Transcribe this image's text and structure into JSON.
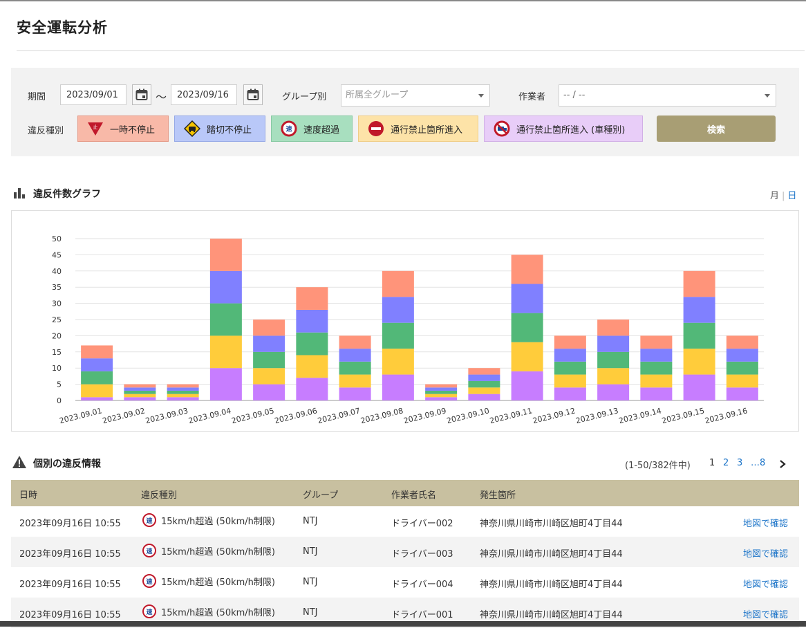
{
  "page": {
    "title": "安全運転分析"
  },
  "filters": {
    "period_label": "期間",
    "date_from": "2023/09/01",
    "date_to": "2023/09/16",
    "tilde": "〜",
    "group_label": "グループ別",
    "group_placeholder": "所属全グループ",
    "worker_label": "作業者",
    "worker_value": "-- / --",
    "violation_label": "違反種別",
    "violation_types": [
      {
        "label": "一時不停止",
        "bg": "#f8b9a8",
        "border": "#e59a87",
        "icon": "stop-sign-icon"
      },
      {
        "label": "踏切不停止",
        "bg": "#b9c8f8",
        "border": "#96a9e6",
        "icon": "railroad-crossing-icon"
      },
      {
        "label": "速度超過",
        "bg": "#a8dfbf",
        "border": "#86c9a2",
        "icon": "speed-limit-icon"
      },
      {
        "label": "通行禁止箇所進入",
        "bg": "#fde3a8",
        "border": "#efcd86",
        "icon": "no-entry-icon"
      },
      {
        "label": "通行禁止箇所進入 (車種別)",
        "bg": "#e8cdf8",
        "border": "#d1afe6",
        "icon": "vehicle-prohibited-icon"
      }
    ],
    "search_label": "検索"
  },
  "chart_section": {
    "title": "違反件数グラフ",
    "toggle_month": "月",
    "toggle_day": "日"
  },
  "chart_data": {
    "type": "bar",
    "stacked": true,
    "categories": [
      "2023.09.01",
      "2023.09.02",
      "2023.09.03",
      "2023.09.04",
      "2023.09.05",
      "2023.09.06",
      "2023.09.07",
      "2023.09.08",
      "2023.09.09",
      "2023.09.10",
      "2023.09.11",
      "2023.09.12",
      "2023.09.13",
      "2023.09.14",
      "2023.09.15",
      "2023.09.16"
    ],
    "series": [
      {
        "color": "#c77dff",
        "values": [
          1,
          1,
          1,
          10,
          5,
          7,
          4,
          8,
          1,
          2,
          9,
          4,
          5,
          4,
          8,
          4
        ]
      },
      {
        "color": "#ffcc3b",
        "values": [
          4,
          1,
          1,
          10,
          5,
          7,
          4,
          8,
          1,
          2,
          9,
          4,
          5,
          4,
          8,
          4
        ]
      },
      {
        "color": "#52b878",
        "values": [
          4,
          1,
          1,
          10,
          5,
          7,
          4,
          8,
          1,
          2,
          9,
          4,
          5,
          4,
          8,
          4
        ]
      },
      {
        "color": "#8080ff",
        "values": [
          4,
          1,
          1,
          10,
          5,
          7,
          4,
          8,
          1,
          2,
          9,
          4,
          5,
          4,
          8,
          4
        ]
      },
      {
        "color": "#ff947a",
        "values": [
          4,
          1,
          1,
          10,
          5,
          7,
          4,
          8,
          1,
          2,
          9,
          4,
          5,
          4,
          8,
          4
        ]
      }
    ],
    "ylim": [
      0,
      50
    ],
    "yticks": [
      0,
      5,
      10,
      15,
      20,
      25,
      30,
      35,
      40,
      45,
      50
    ],
    "grid": true
  },
  "list_section": {
    "title": "個別の違反情報",
    "range_text": "(1-50/382件中)",
    "pages": [
      "1",
      "2",
      "3",
      "…8"
    ]
  },
  "table": {
    "headers": [
      "日時",
      "違反種別",
      "グループ",
      "作業者氏名",
      "発生箇所"
    ],
    "rows": [
      {
        "datetime": "2023年09月16日 10:55",
        "type_icon": "速",
        "type": "15km/h超過 (50km/h制限)",
        "group": "NTJ",
        "worker": "ドライバー002",
        "location": "神奈川県川崎市川崎区旭町4丁目44",
        "link": "地図で確認"
      },
      {
        "datetime": "2023年09月16日 10:55",
        "type_icon": "速",
        "type": "15km/h超過 (50km/h制限)",
        "group": "NTJ",
        "worker": "ドライバー003",
        "location": "神奈川県川崎市川崎区旭町4丁目44",
        "link": "地図で確認"
      },
      {
        "datetime": "2023年09月16日 10:55",
        "type_icon": "速",
        "type": "15km/h超過 (50km/h制限)",
        "group": "NTJ",
        "worker": "ドライバー004",
        "location": "神奈川県川崎市川崎区旭町4丁目44",
        "link": "地図で確認"
      },
      {
        "datetime": "2023年09月16日 10:55",
        "type_icon": "速",
        "type": "15km/h超過 (50km/h制限)",
        "group": "NTJ",
        "worker": "ドライバー001",
        "location": "神奈川県川崎市川崎区旭町4丁目44",
        "link": "地図で確認"
      }
    ]
  }
}
